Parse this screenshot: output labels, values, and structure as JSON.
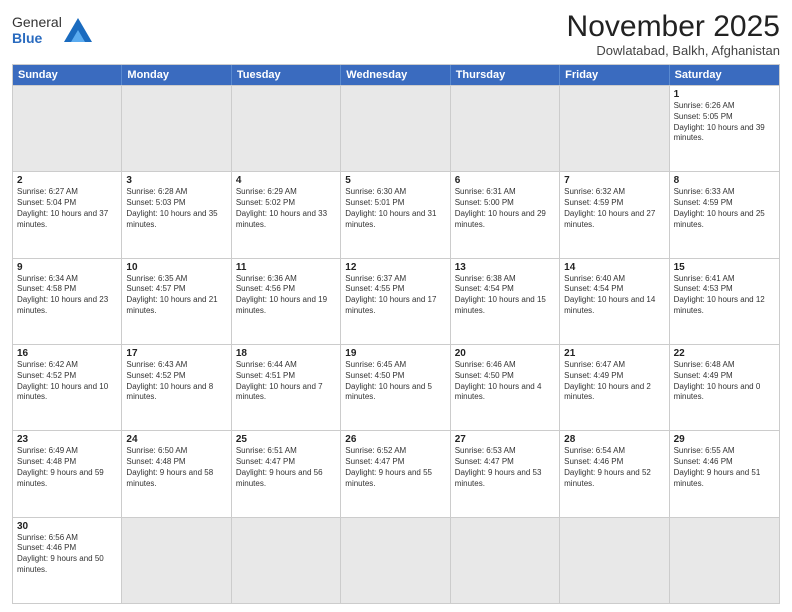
{
  "logo": {
    "text_general": "General",
    "text_blue": "Blue"
  },
  "title": "November 2025",
  "location": "Dowlatabad, Balkh, Afghanistan",
  "header_days": [
    "Sunday",
    "Monday",
    "Tuesday",
    "Wednesday",
    "Thursday",
    "Friday",
    "Saturday"
  ],
  "weeks": [
    [
      {
        "day": "",
        "info": ""
      },
      {
        "day": "",
        "info": ""
      },
      {
        "day": "",
        "info": ""
      },
      {
        "day": "",
        "info": ""
      },
      {
        "day": "",
        "info": ""
      },
      {
        "day": "",
        "info": ""
      },
      {
        "day": "1",
        "info": "Sunrise: 6:26 AM\nSunset: 5:05 PM\nDaylight: 10 hours and 39 minutes."
      }
    ],
    [
      {
        "day": "2",
        "info": "Sunrise: 6:27 AM\nSunset: 5:04 PM\nDaylight: 10 hours and 37 minutes."
      },
      {
        "day": "3",
        "info": "Sunrise: 6:28 AM\nSunset: 5:03 PM\nDaylight: 10 hours and 35 minutes."
      },
      {
        "day": "4",
        "info": "Sunrise: 6:29 AM\nSunset: 5:02 PM\nDaylight: 10 hours and 33 minutes."
      },
      {
        "day": "5",
        "info": "Sunrise: 6:30 AM\nSunset: 5:01 PM\nDaylight: 10 hours and 31 minutes."
      },
      {
        "day": "6",
        "info": "Sunrise: 6:31 AM\nSunset: 5:00 PM\nDaylight: 10 hours and 29 minutes."
      },
      {
        "day": "7",
        "info": "Sunrise: 6:32 AM\nSunset: 4:59 PM\nDaylight: 10 hours and 27 minutes."
      },
      {
        "day": "8",
        "info": "Sunrise: 6:33 AM\nSunset: 4:59 PM\nDaylight: 10 hours and 25 minutes."
      }
    ],
    [
      {
        "day": "9",
        "info": "Sunrise: 6:34 AM\nSunset: 4:58 PM\nDaylight: 10 hours and 23 minutes."
      },
      {
        "day": "10",
        "info": "Sunrise: 6:35 AM\nSunset: 4:57 PM\nDaylight: 10 hours and 21 minutes."
      },
      {
        "day": "11",
        "info": "Sunrise: 6:36 AM\nSunset: 4:56 PM\nDaylight: 10 hours and 19 minutes."
      },
      {
        "day": "12",
        "info": "Sunrise: 6:37 AM\nSunset: 4:55 PM\nDaylight: 10 hours and 17 minutes."
      },
      {
        "day": "13",
        "info": "Sunrise: 6:38 AM\nSunset: 4:54 PM\nDaylight: 10 hours and 15 minutes."
      },
      {
        "day": "14",
        "info": "Sunrise: 6:40 AM\nSunset: 4:54 PM\nDaylight: 10 hours and 14 minutes."
      },
      {
        "day": "15",
        "info": "Sunrise: 6:41 AM\nSunset: 4:53 PM\nDaylight: 10 hours and 12 minutes."
      }
    ],
    [
      {
        "day": "16",
        "info": "Sunrise: 6:42 AM\nSunset: 4:52 PM\nDaylight: 10 hours and 10 minutes."
      },
      {
        "day": "17",
        "info": "Sunrise: 6:43 AM\nSunset: 4:52 PM\nDaylight: 10 hours and 8 minutes."
      },
      {
        "day": "18",
        "info": "Sunrise: 6:44 AM\nSunset: 4:51 PM\nDaylight: 10 hours and 7 minutes."
      },
      {
        "day": "19",
        "info": "Sunrise: 6:45 AM\nSunset: 4:50 PM\nDaylight: 10 hours and 5 minutes."
      },
      {
        "day": "20",
        "info": "Sunrise: 6:46 AM\nSunset: 4:50 PM\nDaylight: 10 hours and 4 minutes."
      },
      {
        "day": "21",
        "info": "Sunrise: 6:47 AM\nSunset: 4:49 PM\nDaylight: 10 hours and 2 minutes."
      },
      {
        "day": "22",
        "info": "Sunrise: 6:48 AM\nSunset: 4:49 PM\nDaylight: 10 hours and 0 minutes."
      }
    ],
    [
      {
        "day": "23",
        "info": "Sunrise: 6:49 AM\nSunset: 4:48 PM\nDaylight: 9 hours and 59 minutes."
      },
      {
        "day": "24",
        "info": "Sunrise: 6:50 AM\nSunset: 4:48 PM\nDaylight: 9 hours and 58 minutes."
      },
      {
        "day": "25",
        "info": "Sunrise: 6:51 AM\nSunset: 4:47 PM\nDaylight: 9 hours and 56 minutes."
      },
      {
        "day": "26",
        "info": "Sunrise: 6:52 AM\nSunset: 4:47 PM\nDaylight: 9 hours and 55 minutes."
      },
      {
        "day": "27",
        "info": "Sunrise: 6:53 AM\nSunset: 4:47 PM\nDaylight: 9 hours and 53 minutes."
      },
      {
        "day": "28",
        "info": "Sunrise: 6:54 AM\nSunset: 4:46 PM\nDaylight: 9 hours and 52 minutes."
      },
      {
        "day": "29",
        "info": "Sunrise: 6:55 AM\nSunset: 4:46 PM\nDaylight: 9 hours and 51 minutes."
      }
    ],
    [
      {
        "day": "30",
        "info": "Sunrise: 6:56 AM\nSunset: 4:46 PM\nDaylight: 9 hours and 50 minutes."
      },
      {
        "day": "",
        "info": ""
      },
      {
        "day": "",
        "info": ""
      },
      {
        "day": "",
        "info": ""
      },
      {
        "day": "",
        "info": ""
      },
      {
        "day": "",
        "info": ""
      },
      {
        "day": "",
        "info": ""
      }
    ]
  ]
}
